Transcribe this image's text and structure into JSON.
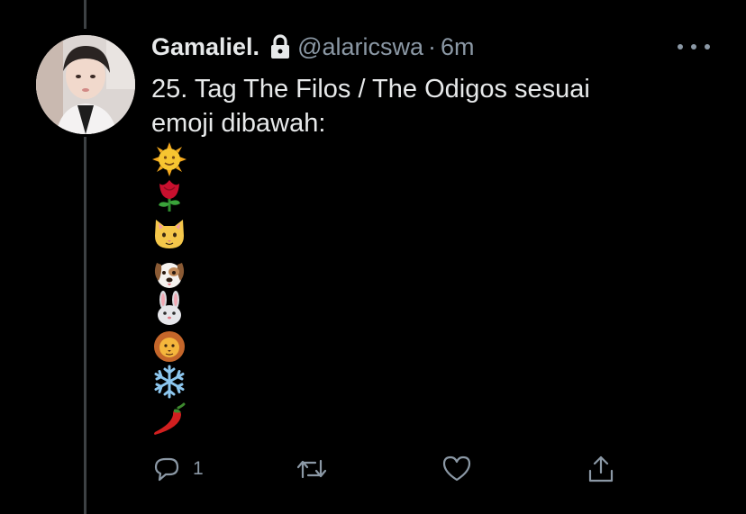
{
  "tweet": {
    "author_name": "Gamaliel.",
    "handle": "@alaricswa",
    "separator": "·",
    "time": "6m",
    "text_lines": [
      "25. Tag The Filos / The Odigos sesuai",
      "emoji dibawah:"
    ],
    "emojis": [
      "sun-with-face",
      "rose",
      "cat-face",
      "dog-face",
      "rabbit-face",
      "lion-face",
      "snowflake",
      "hot-pepper"
    ]
  },
  "actions": {
    "reply_count": "1"
  },
  "colors": {
    "background": "#000000",
    "text_primary": "#e7e9ea",
    "text_secondary": "#8b98a5",
    "thread_line": "#3d4144"
  }
}
